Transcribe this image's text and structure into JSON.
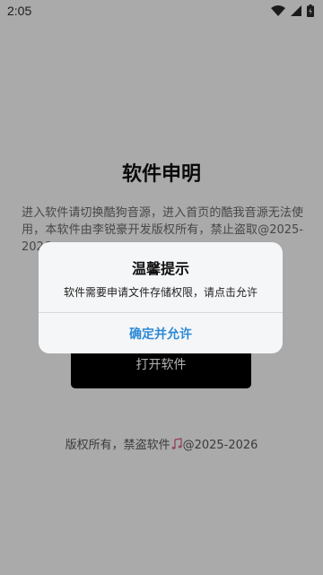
{
  "status_bar": {
    "time": "2:05",
    "icons": [
      "wifi-icon",
      "cellular-signal-icon",
      "battery-charging-icon"
    ]
  },
  "page": {
    "title": "软件申明",
    "notice": "进入软件请切换酷狗音源，进入首页的酷我音源无法使用，本软件由李锐豪开发版权所有，禁止盗取@2025-2026",
    "open_button_label": "打开软件",
    "footer": "版权所有，禁盗软件",
    "footer_emoji": "music-note-icon",
    "footer_years": "@2025-2026"
  },
  "dialog": {
    "title": "温馨提示",
    "message": "软件需要申请文件存储权限，请点击允许",
    "confirm_label": "确定并允许",
    "accent_color": "#2c8ad6"
  }
}
